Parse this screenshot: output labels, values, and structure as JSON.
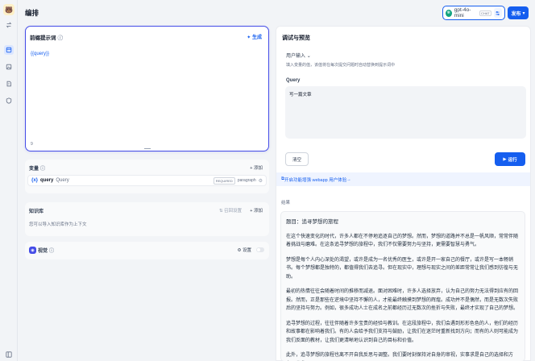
{
  "app": {
    "title": "编排",
    "avatar": "🐻"
  },
  "rail": [
    "apps-icon",
    "layout-icon",
    "chart-icon",
    "document-icon",
    "shield-icon"
  ],
  "model": {
    "name": "gpt-4o-mini",
    "badge": "CHAT",
    "publish_label": "发布"
  },
  "prompt": {
    "title": "前缀提示词",
    "generate_label": "生成",
    "content": "{{query}}",
    "char_count": "9"
  },
  "variables": {
    "title": "变量",
    "add_label": "添加",
    "items": [
      {
        "key": "query",
        "label": "Query",
        "required": "REQUIRED",
        "type": "paragraph"
      }
    ]
  },
  "knowledge": {
    "title": "知识库",
    "recall_label": "召回设置",
    "add_label": "添加",
    "description": "您可以导入知识库作为上下文"
  },
  "vision": {
    "title": "视觉",
    "settings_label": "设置",
    "enabled": false
  },
  "debug": {
    "title": "调试与预览",
    "user_input_label": "用户输入",
    "user_input_desc": "填入变量的值，该值将在每次提交问题时自动替换到提示词中",
    "query_label": "Query",
    "query_value": "写一篇文章",
    "clear_label": "清空",
    "run_label": "运行",
    "enhance_label": "开启功能增强 webapp 用户体验",
    "results_label": "结果"
  },
  "result": {
    "title": "题目：追寻梦想的旅程",
    "paragraphs": [
      "在这个快速变化的时代，许多人都在不停地追逐自己的梦想。然而，梦想的道路并不总是一帆风顺，常常伴随着挑战与磨难。在这条追寻梦想的旅程中，我们不仅需要努力与坚持，更需要智慧与勇气。",
      "梦想是每个人内心深处的渴望，或许是成为一名优秀的医生，或许是开一家自己的餐厅，或许是写一本畅销书。每个梦想都是独特的，都值得我们去追寻。但在现实中，理想与现实之间的差距常常让我们感到彷徨与无助。",
      "最初的热情往往会随着时间的推移而减退。面对困难时，许多人选择放弃，认为自己的努力无法得到应有的回报。然而，正是那些在逆境中坚持不懈的人，才能最终触摸到梦想的辉煌。成功并不是偶然，而是无数次失败后的坚持与努力。例如，很多成功人士在成名之前都经历过无数次的挫折与失败，最终才实现了自己的梦想。",
      "追寻梦想的过程，往往伴随着许多宝贵的经验与教训。在这段旅程中，我们会遇到形形色色的人，他们的经历和故事都在影响着我们。有的人会给予我们支持与鼓励，让我们在迷茫时重新找到方向；而有的人则可能成为我们反面的教材，让我们更清晰地认识到自己的目标和价值。",
      "此外，追寻梦想的旅程也离不开自我反思与调整。我们要时刻保持对自身的审视，实事求是自己的选择和方向。当我"
    ]
  },
  "colors": {
    "accent": "#155eef",
    "prompt_border": "#444ce7",
    "background": "#f2f4f7"
  }
}
